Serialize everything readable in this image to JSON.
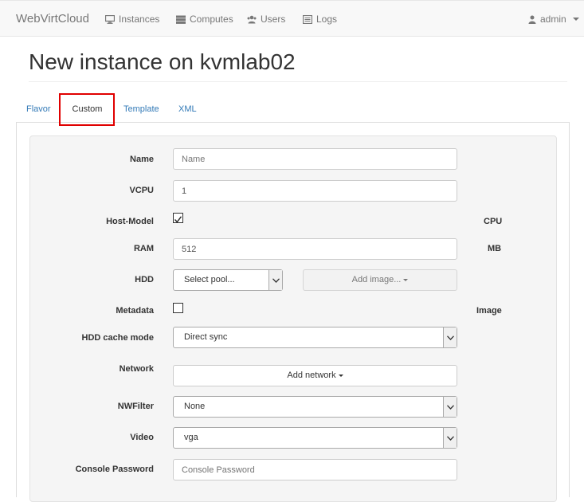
{
  "navbar": {
    "brand": "WebVirtCloud",
    "items": [
      {
        "label": "Instances",
        "icon": "monitor-icon"
      },
      {
        "label": "Computes",
        "icon": "server-icon"
      },
      {
        "label": "Users",
        "icon": "users-icon"
      },
      {
        "label": "Logs",
        "icon": "list-icon"
      }
    ],
    "user": {
      "label": "admin",
      "icon": "user-icon"
    }
  },
  "page": {
    "title": "New instance on kvmlab02"
  },
  "tabs": [
    {
      "label": "Flavor"
    },
    {
      "label": "Custom",
      "active": true
    },
    {
      "label": "Template"
    },
    {
      "label": "XML"
    }
  ],
  "form": {
    "name": {
      "label": "Name",
      "placeholder": "Name",
      "value": ""
    },
    "vcpu": {
      "label": "VCPU",
      "value": "1"
    },
    "host_model": {
      "label": "Host-Model",
      "checked": true,
      "suffix": "CPU"
    },
    "ram": {
      "label": "RAM",
      "value": "512",
      "suffix": "MB"
    },
    "hdd": {
      "label": "HDD",
      "pool_select": "Select pool...",
      "add_image": "Add image..."
    },
    "metadata": {
      "label": "Metadata",
      "checked": false,
      "suffix": "Image"
    },
    "hdd_cache": {
      "label": "HDD cache mode",
      "value": "Direct sync"
    },
    "network": {
      "label": "Network",
      "button": "Add network"
    },
    "nwfilter": {
      "label": "NWFilter",
      "value": "None"
    },
    "video": {
      "label": "Video",
      "value": "vga"
    },
    "console_password": {
      "label": "Console Password",
      "placeholder": "Console Password",
      "value": ""
    }
  },
  "colors": {
    "highlight": "#e00000",
    "link": "#337ab7"
  }
}
